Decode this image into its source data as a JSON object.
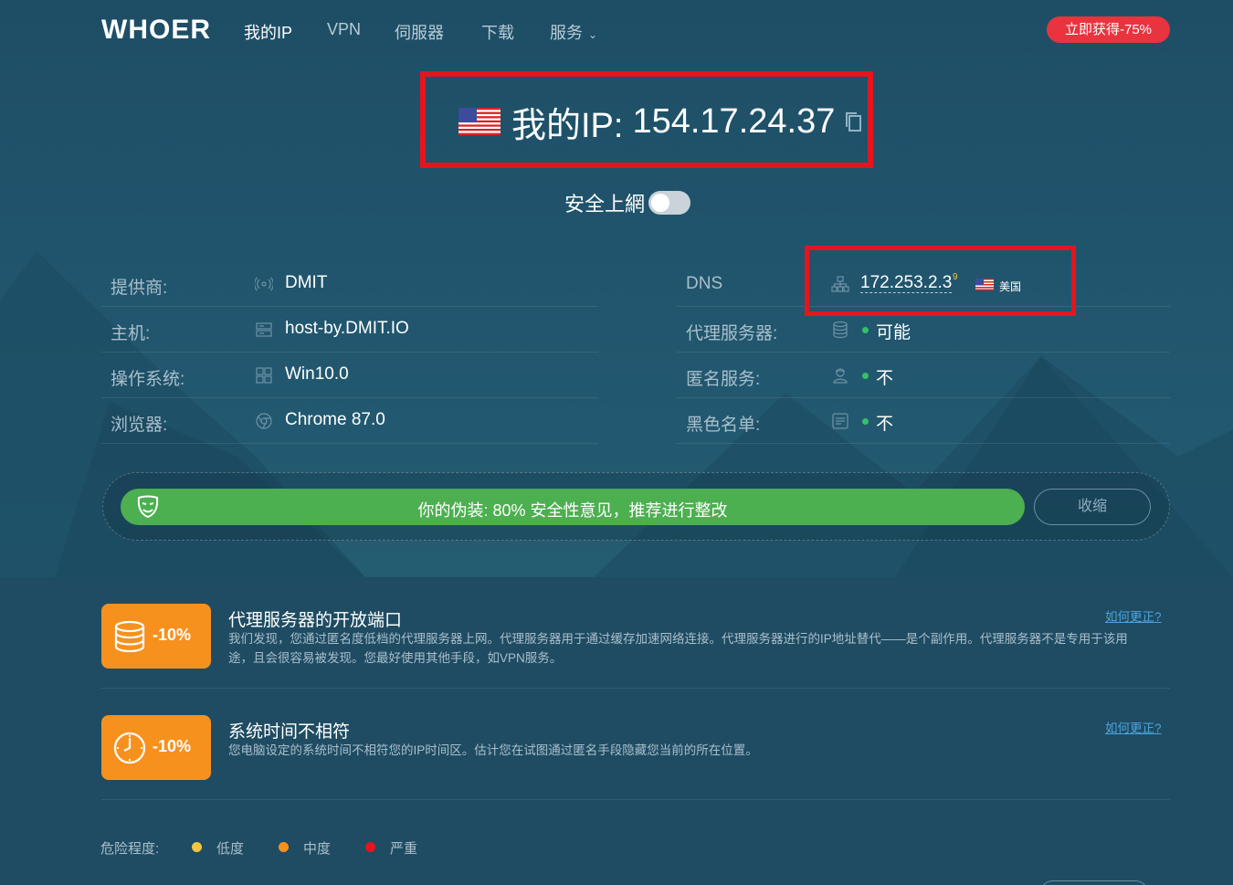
{
  "nav": {
    "logo": "WHOER",
    "items": [
      {
        "label": "我的IP",
        "active": true
      },
      {
        "label": "VPN"
      },
      {
        "label": "伺服器"
      },
      {
        "label": "下载"
      },
      {
        "label": "服务"
      }
    ],
    "services_chevron": "⌄",
    "promo": "立即获得-75%"
  },
  "ip": {
    "label": "我的IP:",
    "value": "154.17.24.37",
    "flag_icon": "us-flag-icon"
  },
  "safe_surfing": {
    "label": "安全上網",
    "enabled": false
  },
  "info_left": [
    {
      "label": "提供商:",
      "icon": "antenna-icon",
      "value": "DMIT"
    },
    {
      "label": "主机:",
      "icon": "server-icon",
      "value": "host-by.DMIT.IO"
    },
    {
      "label": "操作系统:",
      "icon": "windows-icon",
      "value": "Win10.0"
    },
    {
      "label": "浏览器:",
      "icon": "chrome-icon",
      "value": "Chrome 87.0"
    }
  ],
  "info_right": [
    {
      "label": "DNS",
      "icon": "network-icon",
      "value": "172.253.2.3",
      "sup": "9",
      "country": "美国"
    },
    {
      "label": "代理服务器:",
      "icon": "database-icon",
      "value": "可能"
    },
    {
      "label": "匿名服务:",
      "icon": "user-secret-icon",
      "value": "不"
    },
    {
      "label": "黑色名单:",
      "icon": "blacklist-icon",
      "value": "不"
    }
  ],
  "disguise": {
    "text": "你的伪装: 80% 安全性意见，推荐进行整改",
    "percent": 80,
    "collapse": "收缩"
  },
  "issues": [
    {
      "icon": "database-icon",
      "penalty": "-10%",
      "title": "代理服务器的开放端口",
      "desc": "我们发现，您通过匿名度低档的代理服务器上网。代理服务器用于通过缓存加速网络连接。代理服务器进行的IP地址替代——是个副作用。代理服务器不是专用于该用途，且会很容易被发现。您最好使用其他手段，如VPN服务。",
      "link": "如何更正?"
    },
    {
      "icon": "clock-icon",
      "penalty": "-10%",
      "title": "系统时间不相符",
      "desc": "您电脑设定的系统时间不相符您的IP时间区。估计您在试图通过匿名手段隐藏您当前的所在位置。",
      "link": "如何更正?"
    }
  ],
  "legend": {
    "label": "危险程度:",
    "items": [
      {
        "label": "低度",
        "color": "#f5c542"
      },
      {
        "label": "中度",
        "color": "#f7911e"
      },
      {
        "label": "严重",
        "color": "#e4151f"
      }
    ]
  },
  "colors": {
    "highlight_border": "#e4151f",
    "promo": "#e7343f",
    "disguise_bar": "#4caf50",
    "penalty_badge": "#f7911e",
    "link": "#4aa3df"
  }
}
